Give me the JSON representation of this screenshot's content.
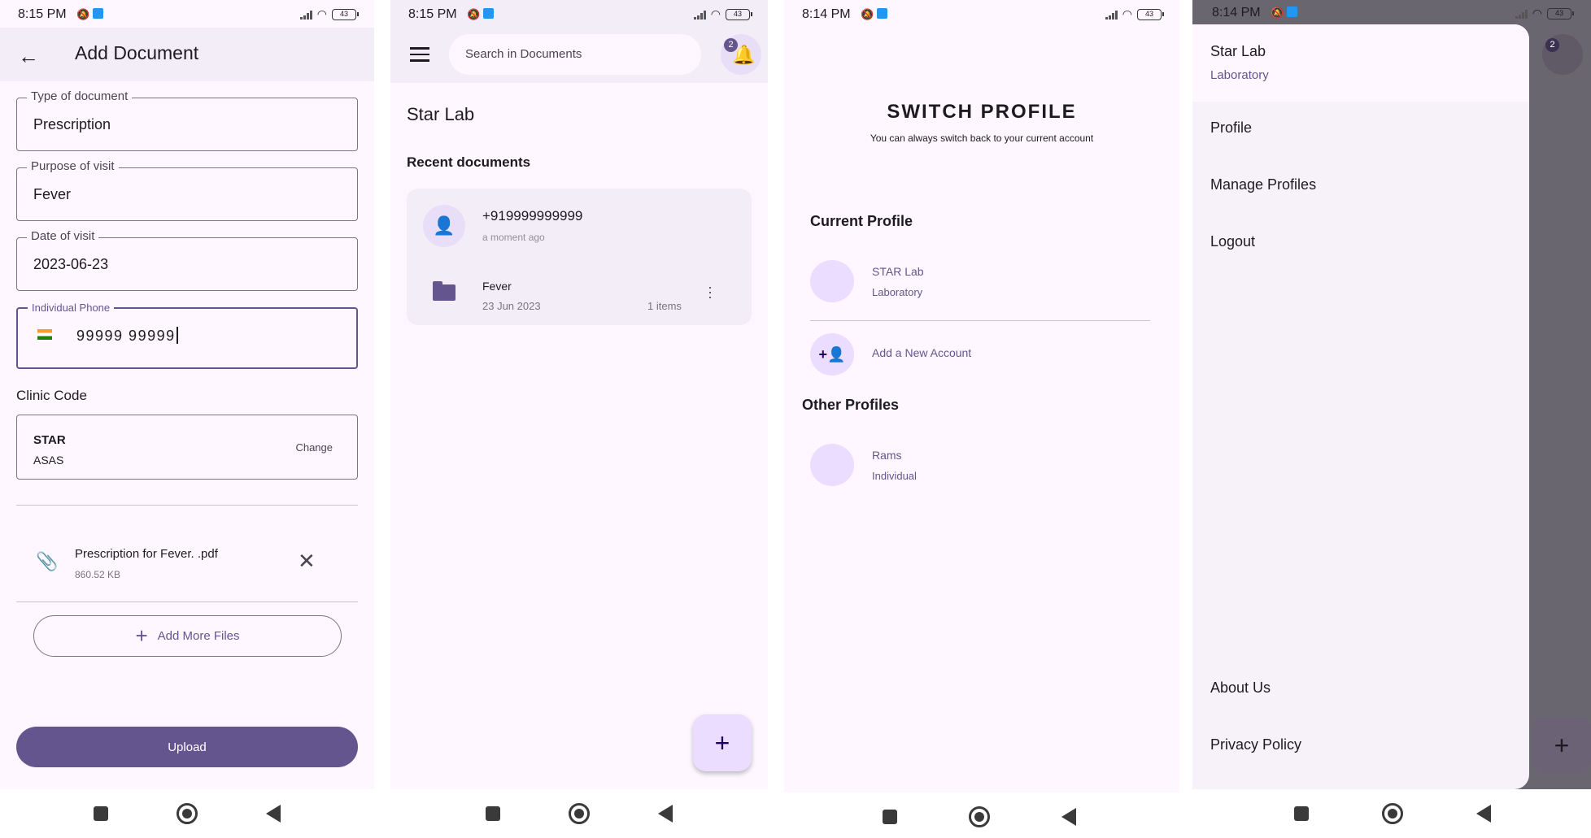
{
  "status_bars": [
    {
      "time": "8:15 PM",
      "battery": "43"
    },
    {
      "time": "8:15 PM",
      "battery": "43"
    },
    {
      "time": "8:14 PM",
      "battery": "43"
    },
    {
      "time": "8:14 PM",
      "battery": "43"
    }
  ],
  "add_document": {
    "title": "Add Document",
    "type_label": "Type of document",
    "type_value": "Prescription",
    "purpose_label": "Purpose of visit",
    "purpose_value": "Fever",
    "date_label": "Date of visit",
    "date_value": "2023-06-23",
    "phone_label": "Individual Phone",
    "phone_value": "99999 99999",
    "clinic_label": "Clinic Code",
    "clinic_code": "STAR",
    "clinic_name": "ASAS",
    "change_label": "Change",
    "file_name": "Prescription for Fever. .pdf",
    "file_size": "860.52 KB",
    "add_more_label": "Add More Files",
    "upload_label": "Upload"
  },
  "documents": {
    "search_placeholder": "Search in Documents",
    "notification_count": "2",
    "org_title": "Star Lab",
    "recent_heading": "Recent documents",
    "card": {
      "phone": "+919999999999",
      "time": "a moment ago",
      "folder_name": "Fever",
      "folder_date": "23 Jun 2023",
      "folder_items": "1 items"
    },
    "fab": "+"
  },
  "switch_profile": {
    "title": "SWITCH PROFILE",
    "subtitle": "You can always switch back to your current account",
    "current_heading": "Current Profile",
    "current_name": "STAR Lab",
    "current_type": "Laboratory",
    "add_account": "Add a New Account",
    "other_heading": "Other Profiles",
    "other_name": "Rams",
    "other_type": "Individual"
  },
  "drawer": {
    "name": "Star Lab",
    "type": "Laboratory",
    "items": [
      "Profile",
      "Manage Profiles",
      "Logout"
    ],
    "bottom_items": [
      "About Us",
      "Privacy Policy"
    ],
    "badge": "2",
    "fab": "+"
  }
}
